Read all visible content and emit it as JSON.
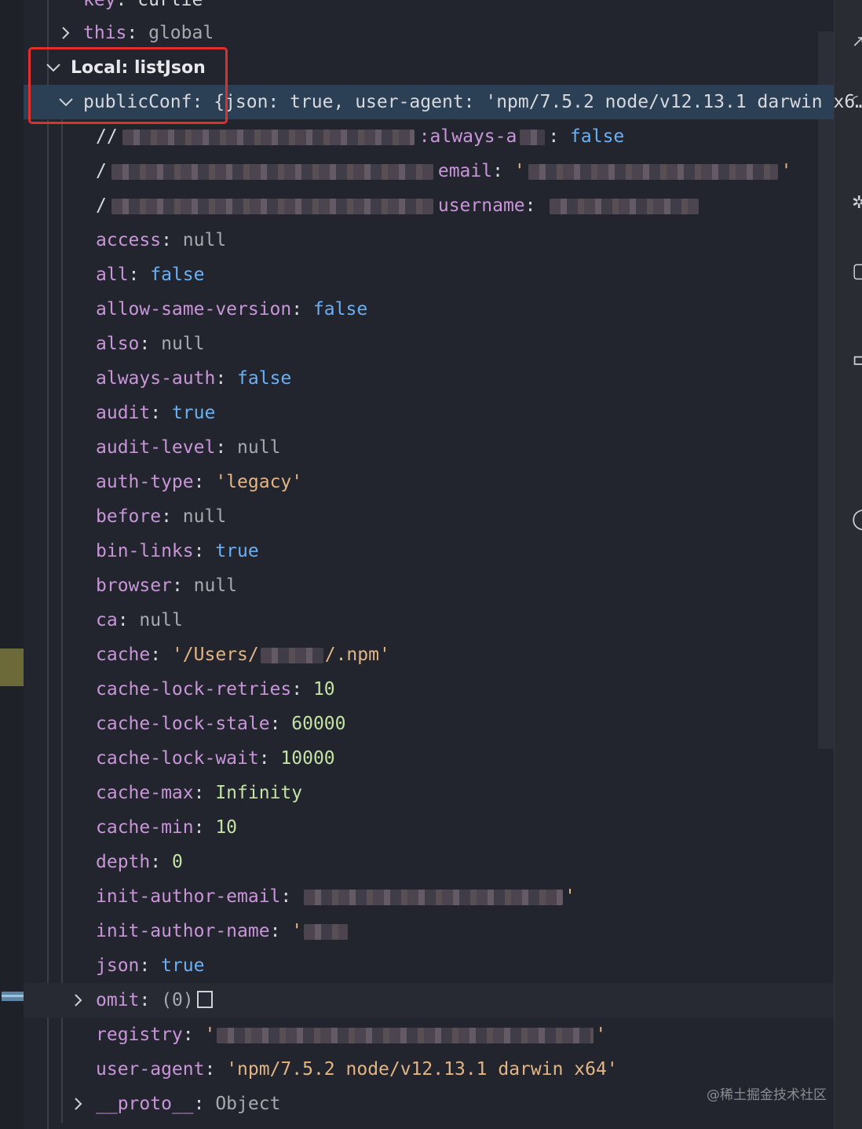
{
  "top_row": {
    "key": "key",
    "value": "curlie"
  },
  "this_row": {
    "key": "this",
    "value": "global"
  },
  "scope": {
    "label": "Local: listJson"
  },
  "public_conf": {
    "key": "publicConf",
    "preview": "{json: true, user-agent: 'npm/7.5.2 node/v12.13.1 darwin x6…"
  },
  "redacted_rows": [
    {
      "key_tail": ":always-a",
      "sep": ": ",
      "value": "false",
      "type": "bool"
    },
    {
      "key_tail": "email",
      "sep": ": ",
      "value": "'",
      "type": "str"
    },
    {
      "key_tail": "username",
      "sep": ": ",
      "value": "",
      "type": "str"
    }
  ],
  "properties": [
    {
      "key": "access",
      "value": "null",
      "type": "null"
    },
    {
      "key": "all",
      "value": "false",
      "type": "bool"
    },
    {
      "key": "allow-same-version",
      "value": "false",
      "type": "bool"
    },
    {
      "key": "also",
      "value": "null",
      "type": "null"
    },
    {
      "key": "always-auth",
      "value": "false",
      "type": "bool"
    },
    {
      "key": "audit",
      "value": "true",
      "type": "bool"
    },
    {
      "key": "audit-level",
      "value": "null",
      "type": "null"
    },
    {
      "key": "auth-type",
      "value": "'legacy'",
      "type": "str"
    },
    {
      "key": "before",
      "value": "null",
      "type": "null"
    },
    {
      "key": "bin-links",
      "value": "true",
      "type": "bool"
    },
    {
      "key": "browser",
      "value": "null",
      "type": "null"
    },
    {
      "key": "ca",
      "value": "null",
      "type": "null"
    },
    {
      "key": "cache",
      "value": "'/Users/",
      "value_tail": "/.npm'",
      "type": "str"
    },
    {
      "key": "cache-lock-retries",
      "value": "10",
      "type": "num"
    },
    {
      "key": "cache-lock-stale",
      "value": "60000",
      "type": "num"
    },
    {
      "key": "cache-lock-wait",
      "value": "10000",
      "type": "num"
    },
    {
      "key": "cache-max",
      "value": "Infinity",
      "type": "num"
    },
    {
      "key": "cache-min",
      "value": "10",
      "type": "num"
    },
    {
      "key": "depth",
      "value": "0",
      "type": "num"
    },
    {
      "key": "init-author-email",
      "value": "",
      "value_tail": "'",
      "type": "str"
    },
    {
      "key": "init-author-name",
      "value": "'",
      "type": "str"
    },
    {
      "key": "json",
      "value": "true",
      "type": "bool"
    }
  ],
  "omit_row": {
    "key": "omit",
    "value": "(0)"
  },
  "registry_row": {
    "key": "registry",
    "value": "'",
    "value_tail": "'"
  },
  "user_agent_row": {
    "key": "user-agent",
    "value": "'npm/7.5.2 node/v12.13.1 darwin x64'"
  },
  "proto_row": {
    "key": "__proto__",
    "value": "Object"
  },
  "watermark": "@稀土掘金技术社区",
  "colors": {
    "highlight": "#2b3f55",
    "annotation": "#e0302c",
    "key": "#c895d9",
    "boolean": "#6ab0f3",
    "number": "#c4e2a6",
    "string": "#e3b584"
  }
}
